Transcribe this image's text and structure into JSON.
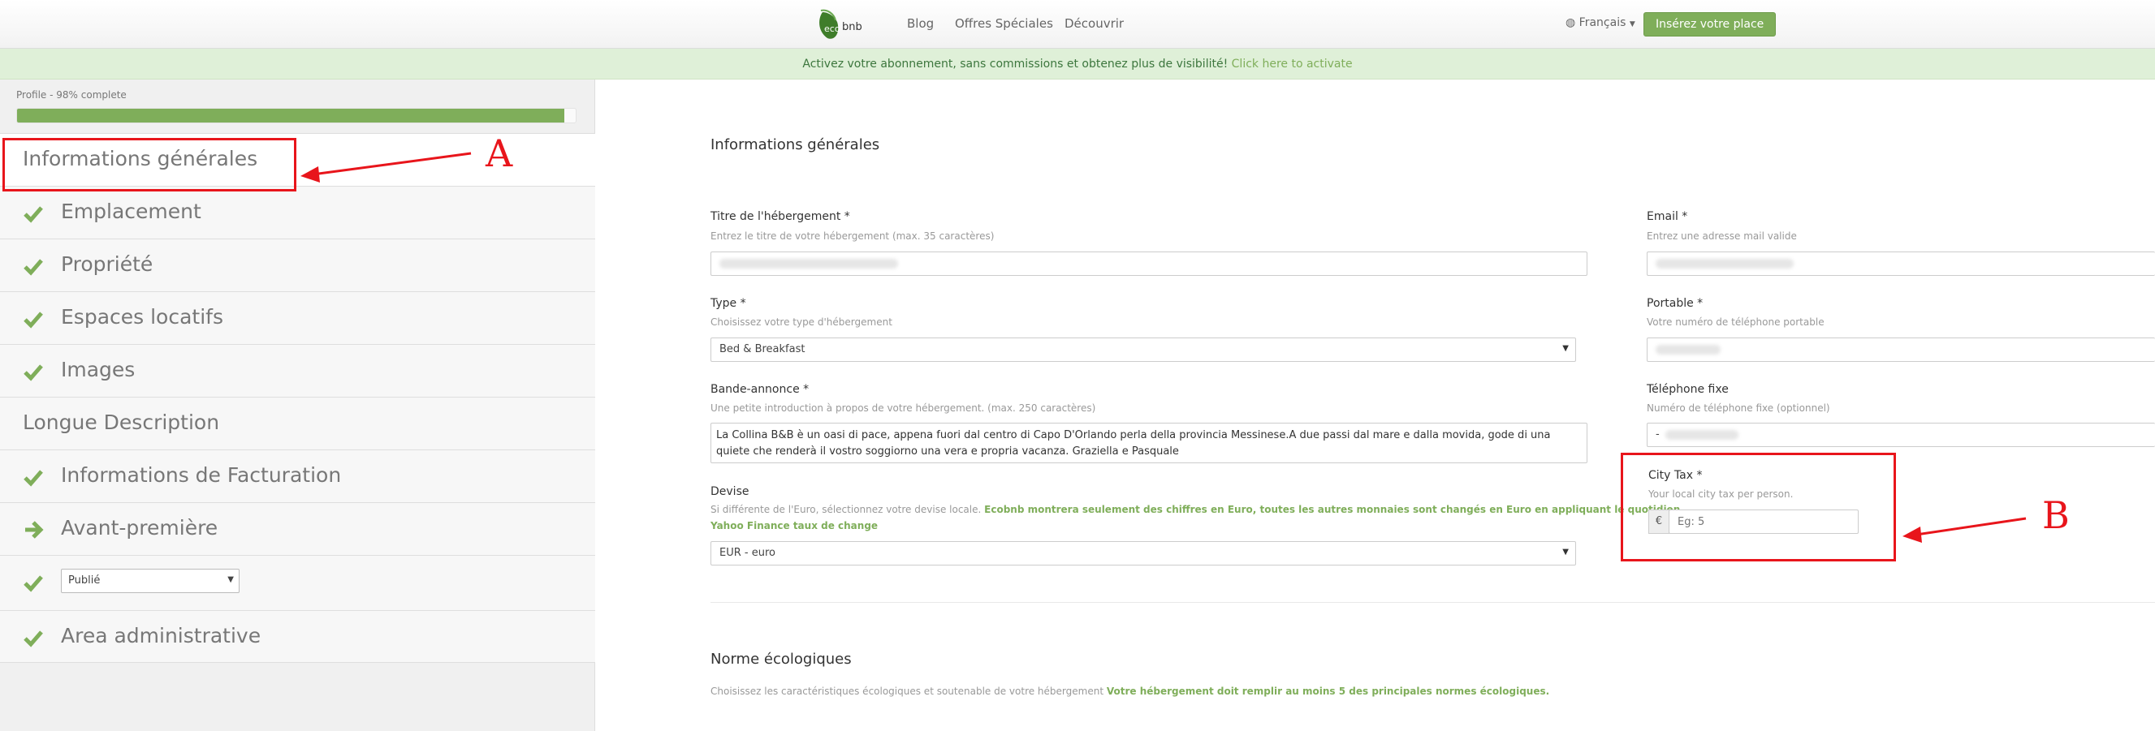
{
  "navbar": {
    "logo_text": "eco bnb",
    "links": [
      "Blog",
      "Offres Spéciales",
      "Découvrir"
    ],
    "language": "Français",
    "cta_label": "Insérez votre place"
  },
  "promo": {
    "text": "Activez votre abonnement, sans commissions et obtenez plus de visibilité!",
    "link": "Click here to activate"
  },
  "sidebar": {
    "profile_label": "Profile - 98% complete",
    "progress_percent": 98,
    "items": [
      {
        "label": "Informations générales",
        "icon": "none"
      },
      {
        "label": "Emplacement",
        "icon": "check-icon"
      },
      {
        "label": "Propriété",
        "icon": "check-icon"
      },
      {
        "label": "Espaces locatifs",
        "icon": "check-icon"
      },
      {
        "label": "Images",
        "icon": "check-icon"
      },
      {
        "label": "Longue Description",
        "icon": "none"
      },
      {
        "label": "Informations de Facturation",
        "icon": "check-icon"
      },
      {
        "label": "Avant-première",
        "icon": "arrow-right-icon"
      },
      {
        "label": "",
        "icon": "check-icon"
      },
      {
        "label": "Area administrative",
        "icon": "check-icon"
      }
    ],
    "status_select": "Publié"
  },
  "form": {
    "section_title": "Informations générales",
    "titre": {
      "label": "Titre de l'hébergement *",
      "help": "Entrez le titre de votre hébergement (max. 35 caractères)"
    },
    "type": {
      "label": "Type *",
      "help": "Choisissez votre type d'hébergement",
      "value": "Bed & Breakfast"
    },
    "bande": {
      "label": "Bande-annonce *",
      "help": "Une petite introduction à propos de votre hébergement. (max. 250 caractères)",
      "value": "La Collina B&B è un oasi di pace, appena fuori dal centro di Capo D'Orlando perla della provincia Messinese.A due passi dal mare e dalla movida, gode di una quiete che renderà il vostro soggiorno una vera e propria vacanza. Graziella e Pasquale"
    },
    "devise": {
      "label": "Devise",
      "help_plain": "Si différente de l'Euro, sélectionnez votre devise locale.",
      "help_bold_1": "Ecobnb montrera seulement des chiffres en Euro, toutes les autres monnaies sont changés en Euro en appliquant le quotidien",
      "help_bold_2": "Yahoo Finance taux de change",
      "value": "EUR - euro"
    },
    "email": {
      "label": "Email *",
      "help": "Entrez une adresse mail valide"
    },
    "portable": {
      "label": "Portable *",
      "help": "Votre numéro de téléphone portable"
    },
    "fixe": {
      "label": "Téléphone fixe",
      "help": "Numéro de téléphone fixe (optionnel)",
      "value": "-"
    },
    "city_tax": {
      "label": "City Tax *",
      "help": "Your local city tax per person.",
      "currency": "€",
      "placeholder": "Eg: 5"
    },
    "eco_title": "Norme écologiques",
    "eco_help_plain": "Choisissez les caractéristiques écologiques et soutenable de votre hébergement",
    "eco_help_bold": "Votre hébergement doit remplir au moins 5 des principales normes écologiques."
  },
  "annotations": {
    "a": "A",
    "b": "B"
  },
  "colors": {
    "accent": "#7fae5a",
    "annotation": "#e8151b"
  }
}
